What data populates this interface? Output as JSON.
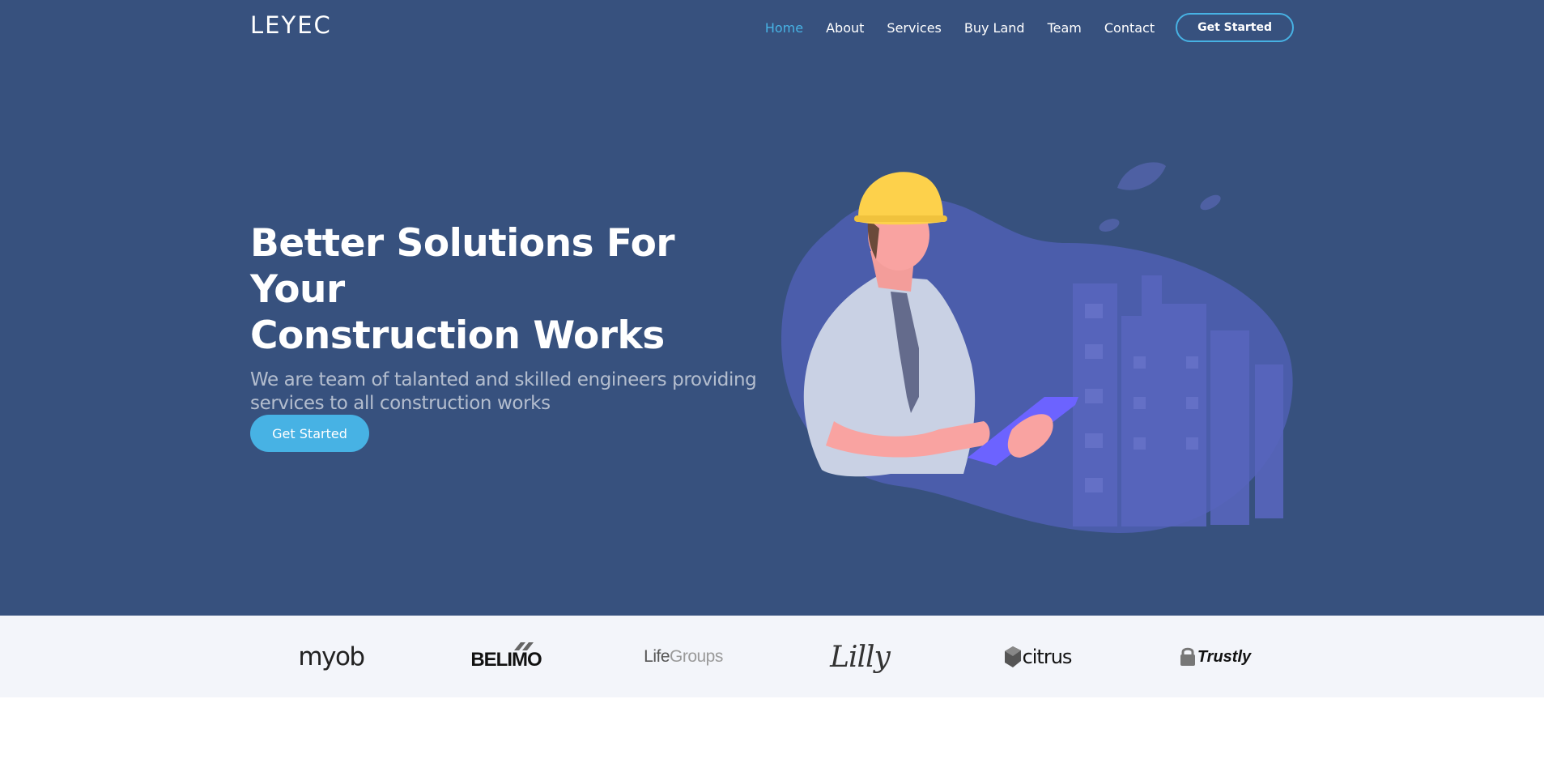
{
  "header": {
    "logo": "LEYEC",
    "nav": [
      {
        "label": "Home",
        "active": true
      },
      {
        "label": "About"
      },
      {
        "label": "Services"
      },
      {
        "label": "Buy Land"
      },
      {
        "label": "Team"
      },
      {
        "label": "Contact"
      }
    ],
    "cta_label": "Get Started"
  },
  "hero": {
    "title_line1": "Better Solutions For Your",
    "title_line2": "Construction Works",
    "subtitle_line1": "We are team of talanted and skilled engineers providing",
    "subtitle_line2": "services to all construction works",
    "button_label": "Get Started"
  },
  "clients": [
    {
      "name": "myob"
    },
    {
      "name": "BELIMO"
    },
    {
      "name_part1": "Life",
      "name_part2": "Groups"
    },
    {
      "name": "Lilly"
    },
    {
      "name": "citrus"
    },
    {
      "name": "Trustly"
    }
  ],
  "colors": {
    "hero_bg": "#37517e",
    "accent": "#47b2e4",
    "clients_bg": "#f3f5fa",
    "blob": "#4f5fb3",
    "helmet": "#fdd14b",
    "tablet": "#6c63ff"
  }
}
